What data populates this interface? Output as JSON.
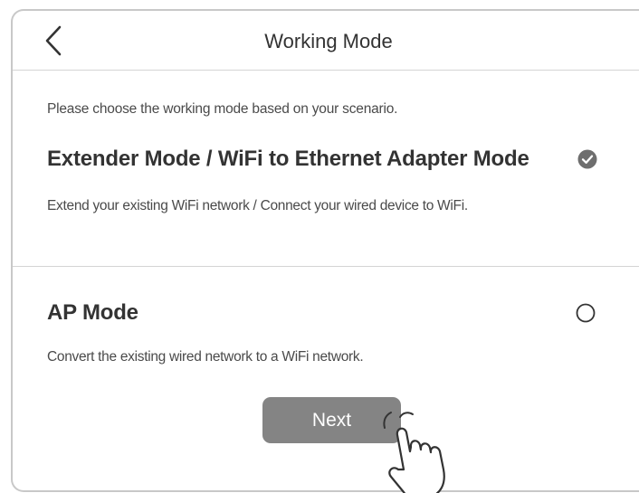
{
  "header": {
    "title": "Working Mode",
    "back_icon": "chevron-left-icon"
  },
  "intro": "Please choose the working mode based on your scenario.",
  "options": [
    {
      "title": "Extender Mode / WiFi to Ethernet Adapter Mode",
      "description": "Extend your existing WiFi network / Connect your wired device to WiFi.",
      "selected": true,
      "icon": "check-circle-icon"
    },
    {
      "title": "AP Mode",
      "description": "Convert the existing wired network to a WiFi network.",
      "selected": false,
      "icon": "radio-empty-icon"
    }
  ],
  "next_label": "Next",
  "cursor_icon": "pointing-hand-icon",
  "colors": {
    "text_dark": "#333333",
    "text_body": "#4a4a4a",
    "button_bg": "#848484",
    "check_fill": "#6e6e6e",
    "divider": "#d4d4d4"
  }
}
